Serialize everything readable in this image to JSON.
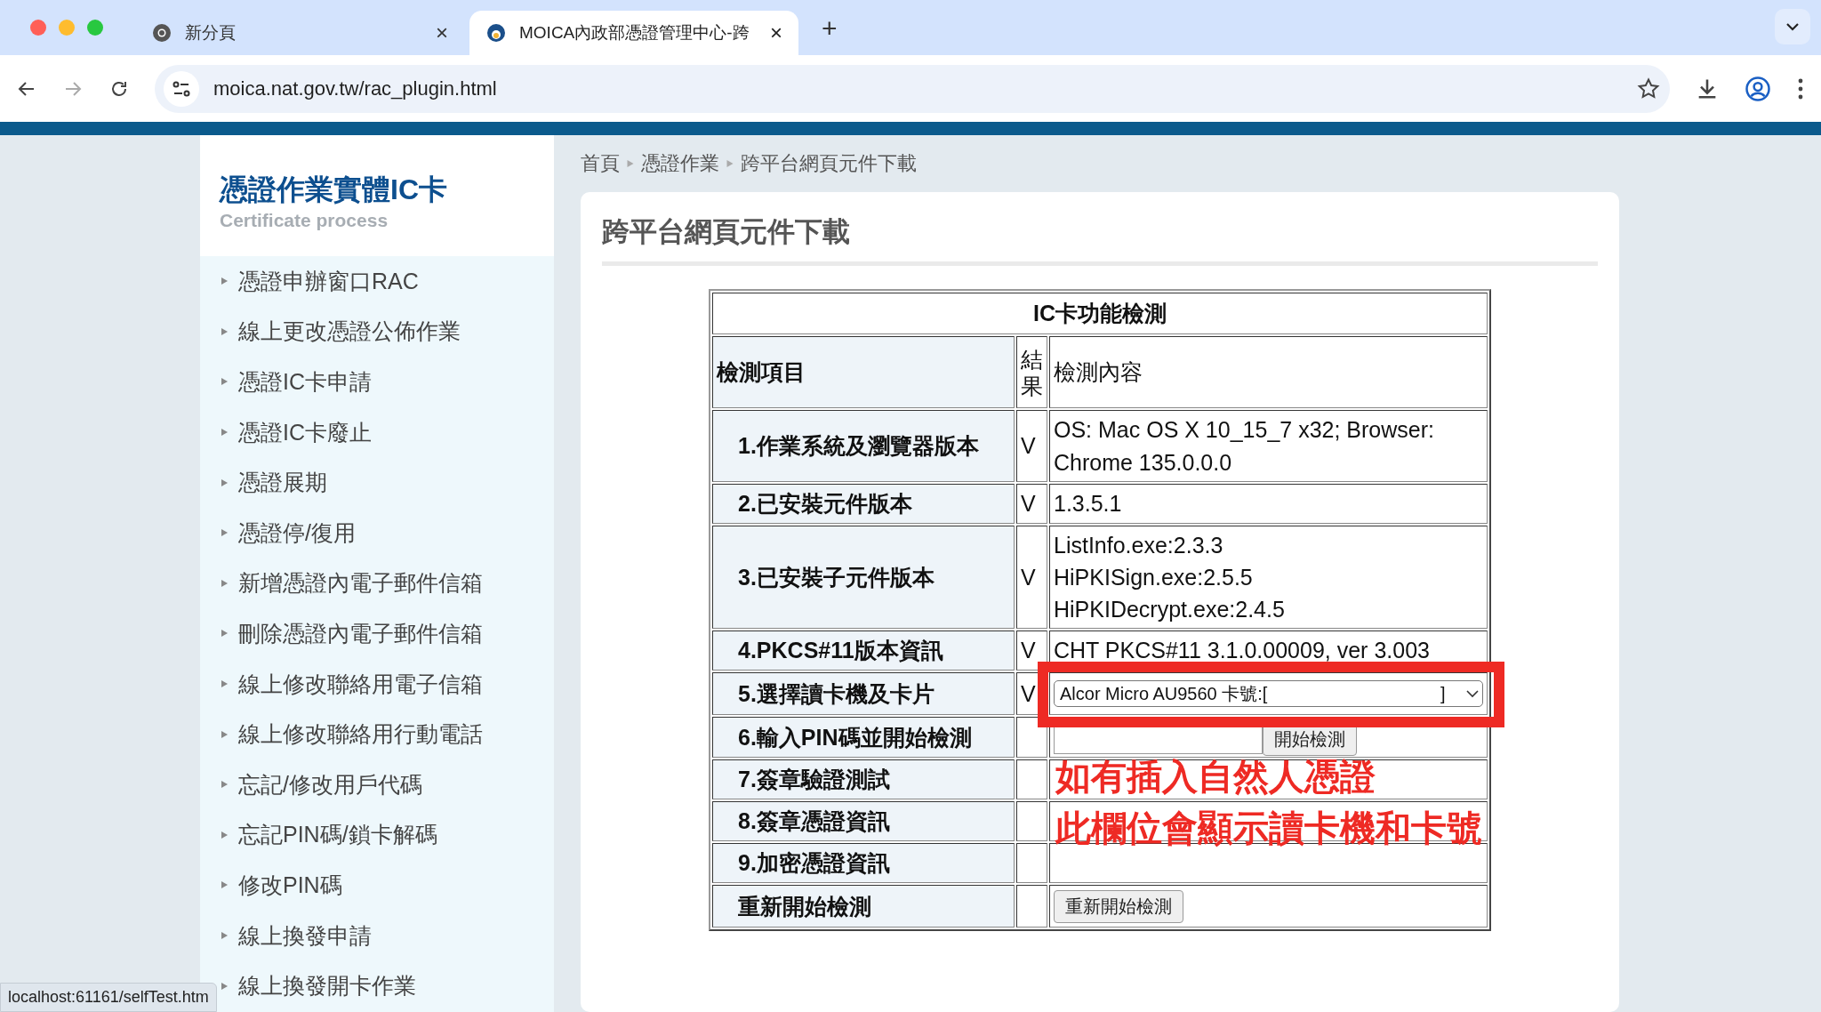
{
  "browser": {
    "tabs": [
      {
        "title": "新分頁",
        "close": "×",
        "selected": false
      },
      {
        "title": "MOICA內政部憑證管理中心-跨",
        "close": "×",
        "selected": true
      }
    ],
    "new_tab": "+",
    "url": "moica.nat.gov.tw/rac_plugin.html"
  },
  "sidebar": {
    "title": "憑證作業實體IC卡",
    "subtitle": "Certificate process",
    "items": [
      {
        "label": "憑證申辦窗口RAC"
      },
      {
        "label": "線上更改憑證公佈作業"
      },
      {
        "label": "憑證IC卡申請"
      },
      {
        "label": "憑證IC卡廢止"
      },
      {
        "label": "憑證展期"
      },
      {
        "label": "憑證停/復用"
      },
      {
        "label": "新增憑證內電子郵件信箱"
      },
      {
        "label": "刪除憑證內電子郵件信箱"
      },
      {
        "label": "線上修改聯絡用電子信箱"
      },
      {
        "label": "線上修改聯絡用行動電話"
      },
      {
        "label": "忘記/修改用戶代碼"
      },
      {
        "label": "忘記PIN碼/鎖卡解碼"
      },
      {
        "label": "修改PIN碼"
      },
      {
        "label": "線上換發申請"
      },
      {
        "label": "線上換發開卡作業"
      }
    ]
  },
  "breadcrumb": [
    "首頁",
    "憑證作業",
    "跨平台網頁元件下載"
  ],
  "page_title": "跨平台網頁元件下載",
  "table": {
    "caption": "IC卡功能檢測",
    "columns": [
      "檢測項目",
      "結果",
      "檢測內容"
    ],
    "rows": [
      {
        "item": "1.作業系統及瀏覽器版本",
        "result": "V",
        "kind": "text",
        "lines": [
          "OS: Mac OS X 10_15_7 x32;  Browser: Chrome 135.0.0.0"
        ]
      },
      {
        "item": "2.已安裝元件版本",
        "result": "V",
        "kind": "text",
        "lines": [
          "1.3.5.1"
        ]
      },
      {
        "item": "3.已安裝子元件版本",
        "result": "V",
        "kind": "text",
        "lines": [
          "ListInfo.exe:2.3.3",
          "HiPKISign.exe:2.5.5",
          "HiPKIDecrypt.exe:2.4.5"
        ]
      },
      {
        "item": "4.PKCS#11版本資訊",
        "result": "V",
        "kind": "text",
        "lines": [
          "CHT PKCS#11 3.1.0.00009, ver 3.003"
        ]
      },
      {
        "item": "5.選擇讀卡機及卡片",
        "result": "V",
        "kind": "select",
        "value": "Alcor Micro AU9560 卡號:[                                   ]"
      },
      {
        "item": "6.輸入PIN碼並開始檢測",
        "kind": "pin",
        "button": "開始檢測"
      },
      {
        "item": "7.簽章驗證測試",
        "kind": "empty"
      },
      {
        "item": "8.簽章憑證資訊",
        "kind": "empty"
      },
      {
        "item": "9.加密憑證資訊",
        "kind": "empty"
      },
      {
        "item": "重新開始檢測",
        "kind": "button",
        "button": "重新開始檢測"
      }
    ]
  },
  "annotation": {
    "lines": [
      "如有插入自然人憑證",
      "此欄位會顯示讀卡機和卡號"
    ]
  },
  "status_bar": "localhost:61161/selfTest.htm"
}
